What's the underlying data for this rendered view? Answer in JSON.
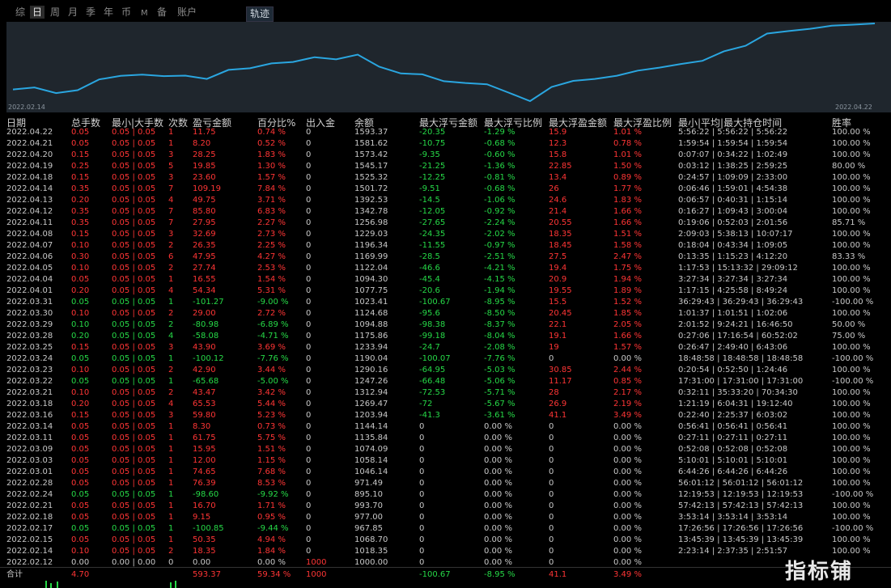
{
  "tabs": [
    "综",
    "日",
    "周",
    "月",
    "季",
    "年",
    "币",
    "M",
    "备",
    "账户"
  ],
  "active_tab": "日",
  "right_tab": "轨迹",
  "chart": {
    "start_label": "2022.02.14",
    "end_label": "2022.04.22",
    "values": [
      1000,
      1018,
      967,
      993,
      1090,
      1122,
      1133,
      1120,
      1124,
      1094,
      1176,
      1190,
      1234,
      1247,
      1290,
      1270,
      1313,
      1204,
      1144,
      1136,
      1074,
      1058,
      1046,
      971,
      895,
      1022,
      1077,
      1094,
      1122,
      1169,
      1196,
      1229,
      1257,
      1343,
      1392,
      1502,
      1525,
      1545,
      1573,
      1582,
      1593
    ]
  },
  "colors": {
    "red": "#ff3535",
    "green": "#26d947",
    "line": "#2aa6e0"
  },
  "headers": [
    "日期",
    "总手数",
    "最小|大手数",
    "次数",
    "盈亏金额",
    "百分比%",
    "出入金",
    "余额",
    "最大浮亏金额",
    "最大浮亏比例",
    "最大浮盈金额",
    "最大浮盈比例",
    "最小|平均|最大持仓时间",
    "胜率"
  ],
  "rows": [
    [
      "2022.04.22",
      "0.05",
      "0.05 | 0.05",
      "1",
      "11.75",
      "0.74 %",
      "0",
      "1593.37",
      "-20.35",
      "-1.29 %",
      "15.9",
      "1.01 %",
      "5:56:22 | 5:56:22 | 5:56:22",
      "100.00 %",
      "r"
    ],
    [
      "2022.04.21",
      "0.05",
      "0.05 | 0.05",
      "1",
      "8.20",
      "0.52 %",
      "0",
      "1581.62",
      "-10.75",
      "-0.68 %",
      "12.3",
      "0.78 %",
      "1:59:54 | 1:59:54 | 1:59:54",
      "100.00 %",
      "r"
    ],
    [
      "2022.04.20",
      "0.15",
      "0.05 | 0.05",
      "3",
      "28.25",
      "1.83 %",
      "0",
      "1573.42",
      "-9.35",
      "-0.60 %",
      "15.8",
      "1.01 %",
      "0:07:07 | 0:34:22 | 1:02:49",
      "100.00 %",
      "r"
    ],
    [
      "2022.04.19",
      "0.25",
      "0.05 | 0.05",
      "5",
      "19.85",
      "1.30 %",
      "0",
      "1545.17",
      "-21.25",
      "-1.36 %",
      "22.85",
      "1.50 %",
      "0:03:12 | 1:38:25 | 2:59:25",
      "80.00 %",
      "r"
    ],
    [
      "2022.04.18",
      "0.15",
      "0.05 | 0.05",
      "3",
      "23.60",
      "1.57 %",
      "0",
      "1525.32",
      "-12.25",
      "-0.81 %",
      "13.4",
      "0.89 %",
      "0:24:57 | 1:09:09 | 2:33:00",
      "100.00 %",
      "r"
    ],
    [
      "2022.04.14",
      "0.35",
      "0.05 | 0.05",
      "7",
      "109.19",
      "7.84 %",
      "0",
      "1501.72",
      "-9.51",
      "-0.68 %",
      "26",
      "1.77 %",
      "0:06:46 | 1:59:01 | 4:54:38",
      "100.00 %",
      "r"
    ],
    [
      "2022.04.13",
      "0.20",
      "0.05 | 0.05",
      "4",
      "49.75",
      "3.71 %",
      "0",
      "1392.53",
      "-14.5",
      "-1.06 %",
      "24.6",
      "1.83 %",
      "0:06:57 | 0:40:31 | 1:15:14",
      "100.00 %",
      "r"
    ],
    [
      "2022.04.12",
      "0.35",
      "0.05 | 0.05",
      "7",
      "85.80",
      "6.83 %",
      "0",
      "1342.78",
      "-12.05",
      "-0.92 %",
      "21.4",
      "1.66 %",
      "0:16:27 | 1:09:43 | 3:00:04",
      "100.00 %",
      "r"
    ],
    [
      "2022.04.11",
      "0.35",
      "0.05 | 0.05",
      "7",
      "27.95",
      "2.27 %",
      "0",
      "1256.98",
      "-27.65",
      "-2.24 %",
      "20.55",
      "1.66 %",
      "0:19:06 | 0:52:03 | 2:01:56",
      "85.71 %",
      "r"
    ],
    [
      "2022.04.08",
      "0.15",
      "0.05 | 0.05",
      "3",
      "32.69",
      "2.73 %",
      "0",
      "1229.03",
      "-24.35",
      "-2.02 %",
      "18.35",
      "1.51 %",
      "2:09:03 | 5:38:13 | 10:07:17",
      "100.00 %",
      "r"
    ],
    [
      "2022.04.07",
      "0.10",
      "0.05 | 0.05",
      "2",
      "26.35",
      "2.25 %",
      "0",
      "1196.34",
      "-11.55",
      "-0.97 %",
      "18.45",
      "1.58 %",
      "0:18:04 | 0:43:34 | 1:09:05",
      "100.00 %",
      "r"
    ],
    [
      "2022.04.06",
      "0.30",
      "0.05 | 0.05",
      "6",
      "47.95",
      "4.27 %",
      "0",
      "1169.99",
      "-28.5",
      "-2.51 %",
      "27.5",
      "2.47 %",
      "0:13:35 | 1:15:23 | 4:12:20",
      "83.33 %",
      "r"
    ],
    [
      "2022.04.05",
      "0.10",
      "0.05 | 0.05",
      "2",
      "27.74",
      "2.53 %",
      "0",
      "1122.04",
      "-46.6",
      "-4.21 %",
      "19.4",
      "1.75 %",
      "1:17:53 | 15:13:32 | 29:09:12",
      "100.00 %",
      "r"
    ],
    [
      "2022.04.04",
      "0.05",
      "0.05 | 0.05",
      "1",
      "16.55",
      "1.54 %",
      "0",
      "1094.30",
      "-45.4",
      "-4.15 %",
      "20.9",
      "1.94 %",
      "3:27:34 | 3:27:34 | 3:27:34",
      "100.00 %",
      "r"
    ],
    [
      "2022.04.01",
      "0.20",
      "0.05 | 0.05",
      "4",
      "54.34",
      "5.31 %",
      "0",
      "1077.75",
      "-20.6",
      "-1.94 %",
      "19.55",
      "1.89 %",
      "1:17:15 | 4:25:58 | 8:49:24",
      "100.00 %",
      "r"
    ],
    [
      "2022.03.31",
      "0.05",
      "0.05 | 0.05",
      "1",
      "-101.27",
      "-9.00 %",
      "0",
      "1023.41",
      "-100.67",
      "-8.95 %",
      "15.5",
      "1.52 %",
      "36:29:43 | 36:29:43 | 36:29:43",
      "-100.00 %",
      "g"
    ],
    [
      "2022.03.30",
      "0.10",
      "0.05 | 0.05",
      "2",
      "29.00",
      "2.72 %",
      "0",
      "1124.68",
      "-95.6",
      "-8.50 %",
      "20.45",
      "1.85 %",
      "1:01:37 | 1:01:51 | 1:02:06",
      "100.00 %",
      "r"
    ],
    [
      "2022.03.29",
      "0.10",
      "0.05 | 0.05",
      "2",
      "-80.98",
      "-6.89 %",
      "0",
      "1094.88",
      "-98.38",
      "-8.37 %",
      "22.1",
      "2.05 %",
      "2:01:52 | 9:24:21 | 16:46:50",
      "50.00 %",
      "g"
    ],
    [
      "2022.03.28",
      "0.20",
      "0.05 | 0.05",
      "4",
      "-58.08",
      "-4.71 %",
      "0",
      "1175.86",
      "-99.18",
      "-8.04 %",
      "19.1",
      "1.66 %",
      "0:27:06 | 17:16:54 | 60:52:02",
      "75.00 %",
      "g"
    ],
    [
      "2022.03.25",
      "0.15",
      "0.05 | 0.05",
      "3",
      "43.90",
      "3.69 %",
      "0",
      "1233.94",
      "-24.7",
      "-2.08 %",
      "19",
      "1.57 %",
      "0:26:47 | 2:49:40 | 6:43:06",
      "100.00 %",
      "r"
    ],
    [
      "2022.03.24",
      "0.05",
      "0.05 | 0.05",
      "1",
      "-100.12",
      "-7.76 %",
      "0",
      "1190.04",
      "-100.07",
      "-7.76 %",
      "0",
      "0.00 %",
      "18:48:58 | 18:48:58 | 18:48:58",
      "-100.00 %",
      "g"
    ],
    [
      "2022.03.23",
      "0.10",
      "0.05 | 0.05",
      "2",
      "42.90",
      "3.44 %",
      "0",
      "1290.16",
      "-64.95",
      "-5.03 %",
      "30.85",
      "2.44 %",
      "0:20:54 | 0:52:50 | 1:24:46",
      "100.00 %",
      "r"
    ],
    [
      "2022.03.22",
      "0.05",
      "0.05 | 0.05",
      "1",
      "-65.68",
      "-5.00 %",
      "0",
      "1247.26",
      "-66.48",
      "-5.06 %",
      "11.17",
      "0.85 %",
      "17:31:00 | 17:31:00 | 17:31:00",
      "-100.00 %",
      "g"
    ],
    [
      "2022.03.21",
      "0.10",
      "0.05 | 0.05",
      "2",
      "43.47",
      "3.42 %",
      "0",
      "1312.94",
      "-72.53",
      "-5.71 %",
      "28",
      "2.17 %",
      "0:32:11 | 35:33:20 | 70:34:30",
      "100.00 %",
      "r"
    ],
    [
      "2022.03.18",
      "0.20",
      "0.05 | 0.05",
      "4",
      "65.53",
      "5.44 %",
      "0",
      "1269.47",
      "-72",
      "-5.67 %",
      "26.9",
      "2.19 %",
      "1:21:19 | 6:04:31 | 19:12:40",
      "100.00 %",
      "r"
    ],
    [
      "2022.03.16",
      "0.15",
      "0.05 | 0.05",
      "3",
      "59.80",
      "5.23 %",
      "0",
      "1203.94",
      "-41.3",
      "-3.61 %",
      "41.1",
      "3.49 %",
      "0:22:40 | 2:25:37 | 6:03:02",
      "100.00 %",
      "r"
    ],
    [
      "2022.03.14",
      "0.05",
      "0.05 | 0.05",
      "1",
      "8.30",
      "0.73 %",
      "0",
      "1144.14",
      "0",
      "0.00 %",
      "0",
      "0.00 %",
      "0:56:41 | 0:56:41 | 0:56:41",
      "100.00 %",
      "r"
    ],
    [
      "2022.03.11",
      "0.05",
      "0.05 | 0.05",
      "1",
      "61.75",
      "5.75 %",
      "0",
      "1135.84",
      "0",
      "0.00 %",
      "0",
      "0.00 %",
      "0:27:11 | 0:27:11 | 0:27:11",
      "100.00 %",
      "r"
    ],
    [
      "2022.03.09",
      "0.05",
      "0.05 | 0.05",
      "1",
      "15.95",
      "1.51 %",
      "0",
      "1074.09",
      "0",
      "0.00 %",
      "0",
      "0.00 %",
      "0:52:08 | 0:52:08 | 0:52:08",
      "100.00 %",
      "r"
    ],
    [
      "2022.03.03",
      "0.05",
      "0.05 | 0.05",
      "1",
      "12.00",
      "1.15 %",
      "0",
      "1058.14",
      "0",
      "0.00 %",
      "0",
      "0.00 %",
      "5:10:01 | 5:10:01 | 5:10:01",
      "100.00 %",
      "r"
    ],
    [
      "2022.03.01",
      "0.05",
      "0.05 | 0.05",
      "1",
      "74.65",
      "7.68 %",
      "0",
      "1046.14",
      "0",
      "0.00 %",
      "0",
      "0.00 %",
      "6:44:26 | 6:44:26 | 6:44:26",
      "100.00 %",
      "r"
    ],
    [
      "2022.02.28",
      "0.05",
      "0.05 | 0.05",
      "1",
      "76.39",
      "8.53 %",
      "0",
      "971.49",
      "0",
      "0.00 %",
      "0",
      "0.00 %",
      "56:01:12 | 56:01:12 | 56:01:12",
      "100.00 %",
      "r"
    ],
    [
      "2022.02.24",
      "0.05",
      "0.05 | 0.05",
      "1",
      "-98.60",
      "-9.92 %",
      "0",
      "895.10",
      "0",
      "0.00 %",
      "0",
      "0.00 %",
      "12:19:53 | 12:19:53 | 12:19:53",
      "-100.00 %",
      "g"
    ],
    [
      "2022.02.21",
      "0.05",
      "0.05 | 0.05",
      "1",
      "16.70",
      "1.71 %",
      "0",
      "993.70",
      "0",
      "0.00 %",
      "0",
      "0.00 %",
      "57:42:13 | 57:42:13 | 57:42:13",
      "100.00 %",
      "r"
    ],
    [
      "2022.02.18",
      "0.05",
      "0.05 | 0.05",
      "1",
      "9.15",
      "0.95 %",
      "0",
      "977.00",
      "0",
      "0.00 %",
      "0",
      "0.00 %",
      "3:53:14 | 3:53:14 | 3:53:14",
      "100.00 %",
      "r"
    ],
    [
      "2022.02.17",
      "0.05",
      "0.05 | 0.05",
      "1",
      "-100.85",
      "-9.44 %",
      "0",
      "967.85",
      "0",
      "0.00 %",
      "0",
      "0.00 %",
      "17:26:56 | 17:26:56 | 17:26:56",
      "-100.00 %",
      "g"
    ],
    [
      "2022.02.15",
      "0.05",
      "0.05 | 0.05",
      "1",
      "50.35",
      "4.94 %",
      "0",
      "1068.70",
      "0",
      "0.00 %",
      "0",
      "0.00 %",
      "13:45:39 | 13:45:39 | 13:45:39",
      "100.00 %",
      "r"
    ],
    [
      "2022.02.14",
      "0.10",
      "0.05 | 0.05",
      "2",
      "18.35",
      "1.84 %",
      "0",
      "1018.35",
      "0",
      "0.00 %",
      "0",
      "0.00 %",
      "2:23:14 | 2:37:35 | 2:51:57",
      "100.00 %",
      "r"
    ],
    [
      "2022.02.12",
      "0.00",
      "0.00 | 0.00",
      "0",
      "0.00",
      "0.00 %",
      "1000",
      "1000.00",
      "0",
      "0.00 %",
      "0",
      "0.00 %",
      "",
      "",
      "w"
    ]
  ],
  "total": {
    "label": "合计",
    "lots": "4.70",
    "pnl": "593.37",
    "pct": "59.34 %",
    "inout": "1000",
    "max_float_loss": "-100.67",
    "max_float_loss_pct": "-8.95 %",
    "max_float_profit": "41.1",
    "max_float_profit_pct": "3.49 %"
  },
  "watermark": "指标铺"
}
